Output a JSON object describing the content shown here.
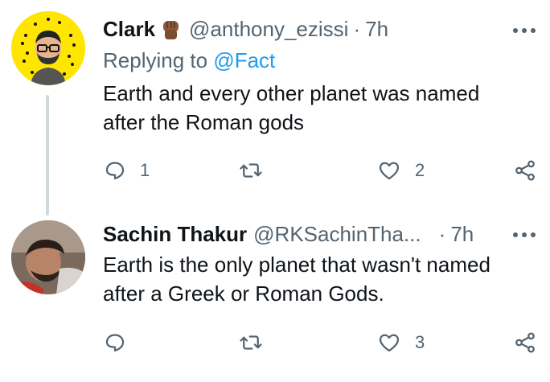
{
  "tweets": [
    {
      "name": "Clark",
      "handle": "@anthony_ezissi",
      "separator": "·",
      "time": "7h",
      "reply_prefix": "Replying to",
      "reply_mention": "@Fact",
      "text_line1": "Earth and every other planet was named",
      "text_line2": "after the Roman gods",
      "replies": "1",
      "retweets": "",
      "likes": "2",
      "icons": {
        "emoji": "raised-fist-emoji",
        "more": "more-icon",
        "reply": "reply-icon",
        "retweet": "retweet-icon",
        "like": "heart-icon",
        "share": "share-icon"
      }
    },
    {
      "name": "Sachin Thakur",
      "handle": "@RKSachinTha...",
      "separator": "·",
      "time": "7h",
      "text_line1": "Earth is the only planet that wasn't named",
      "text_line2": "after a Greek or Roman Gods.",
      "replies": "",
      "retweets": "",
      "likes": "3"
    }
  ],
  "colors": {
    "text": "#0f1419",
    "secondary": "#536471",
    "link": "#1d9bf0",
    "thread_line": "#cfd9de",
    "avatar1_bg": "#ffe600"
  }
}
